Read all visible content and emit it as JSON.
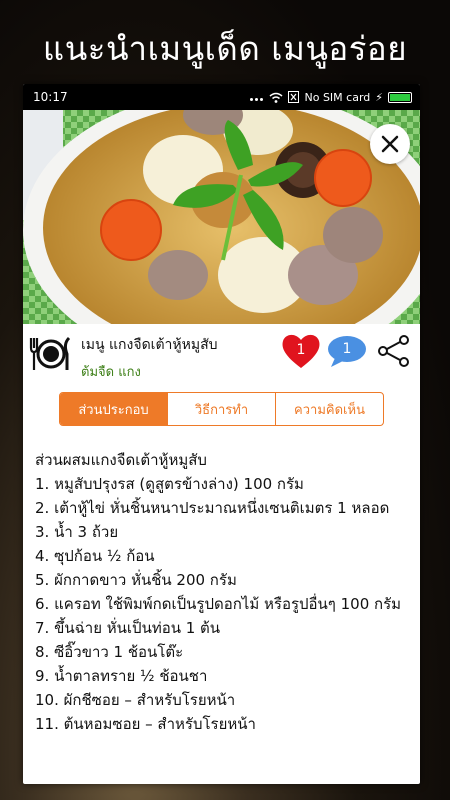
{
  "headline": "แนะนำเมนูเด็ด เมนูอร่อย",
  "status": {
    "time": "10:17",
    "sim": "No SIM card"
  },
  "dish": {
    "name": "เมนู แกงจืดเต้าหู้หมูสับ",
    "tags": "ต้มจืด แกง",
    "likes": "1",
    "comments": "1"
  },
  "tabs": [
    "ส่วนประกอบ",
    "วิธีการทำ",
    "ความคิดเห็น"
  ],
  "content": {
    "title": "ส่วนผสมแกงจืดเต้าหู้หมูสับ",
    "ingredients": [
      " 1. หมูสับปรุงรส (ดูสูตรข้างล่าง) 100 กรัม",
      " 2. เต้าหู้ไข่ หั่นชิ้นหนาประมาณหนึ่งเซนติเมตร 1 หลอด",
      " 3. น้ำ 3 ถ้วย",
      " 4. ซุปก้อน ½ ก้อน",
      " 5. ผักกาดขาว หั่นชิ้น 200 กรัม",
      " 6. แครอท ใช้พิมพ์กดเป็นรูปดอกไม้ หรือรูปอื่นๆ 100 กรัม",
      " 7. ขึ้นฉ่าย หั่นเป็นท่อน 1 ต้น",
      " 8. ซีอิ๊วขาว 1 ช้อนโต๊ะ",
      " 9. น้ำตาลทราย ½ ช้อนชา",
      " 10. ผักชีซอย – สำหรับโรยหน้า",
      " 11. ต้นหอมซอย – สำหรับโรยหน้า"
    ]
  },
  "colors": {
    "accent": "#ee7a28",
    "tag_green": "#3d7f17",
    "heart": "#e0141e",
    "bubble": "#4a90e2"
  }
}
